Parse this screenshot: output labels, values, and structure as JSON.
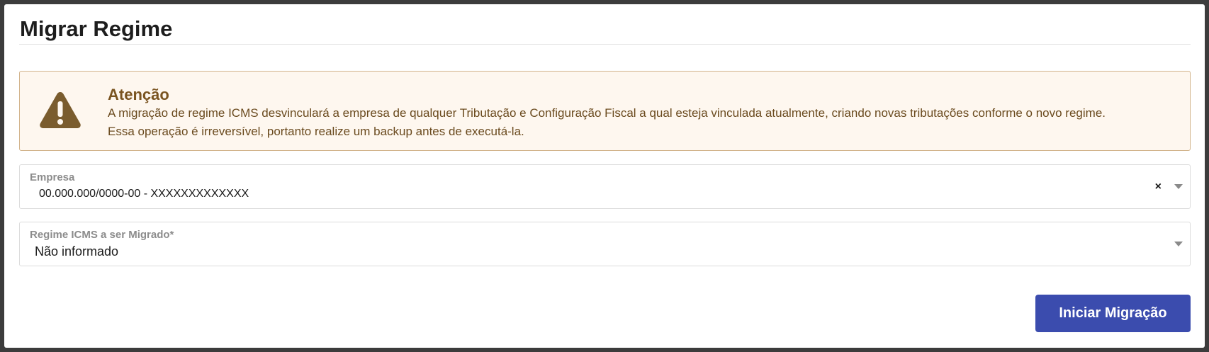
{
  "dialog": {
    "title": "Migrar Regime"
  },
  "alert": {
    "icon": "warning-triangle-icon",
    "icon_color": "#7a5c2e",
    "title": "Atenção",
    "line1": "A migração de regime ICMS desvinculará a empresa de qualquer Tributação e Configuração Fiscal a qual esteja vinculada atualmente, criando novas tributações conforme o novo regime.",
    "line2": "Essa operação é irreversível, portanto realize um backup antes de executá-la."
  },
  "empresa": {
    "label": "Empresa",
    "value": "00.000.000/0000-00 - XXXXXXXXXXXXX",
    "clear_glyph": "×",
    "caret": "chevron-down-icon"
  },
  "regime": {
    "label": "Regime ICMS a ser Migrado*",
    "value": "Não informado",
    "caret": "chevron-down-icon"
  },
  "actions": {
    "start_label": "Iniciar Migração",
    "start_color": "#3b4cae"
  }
}
